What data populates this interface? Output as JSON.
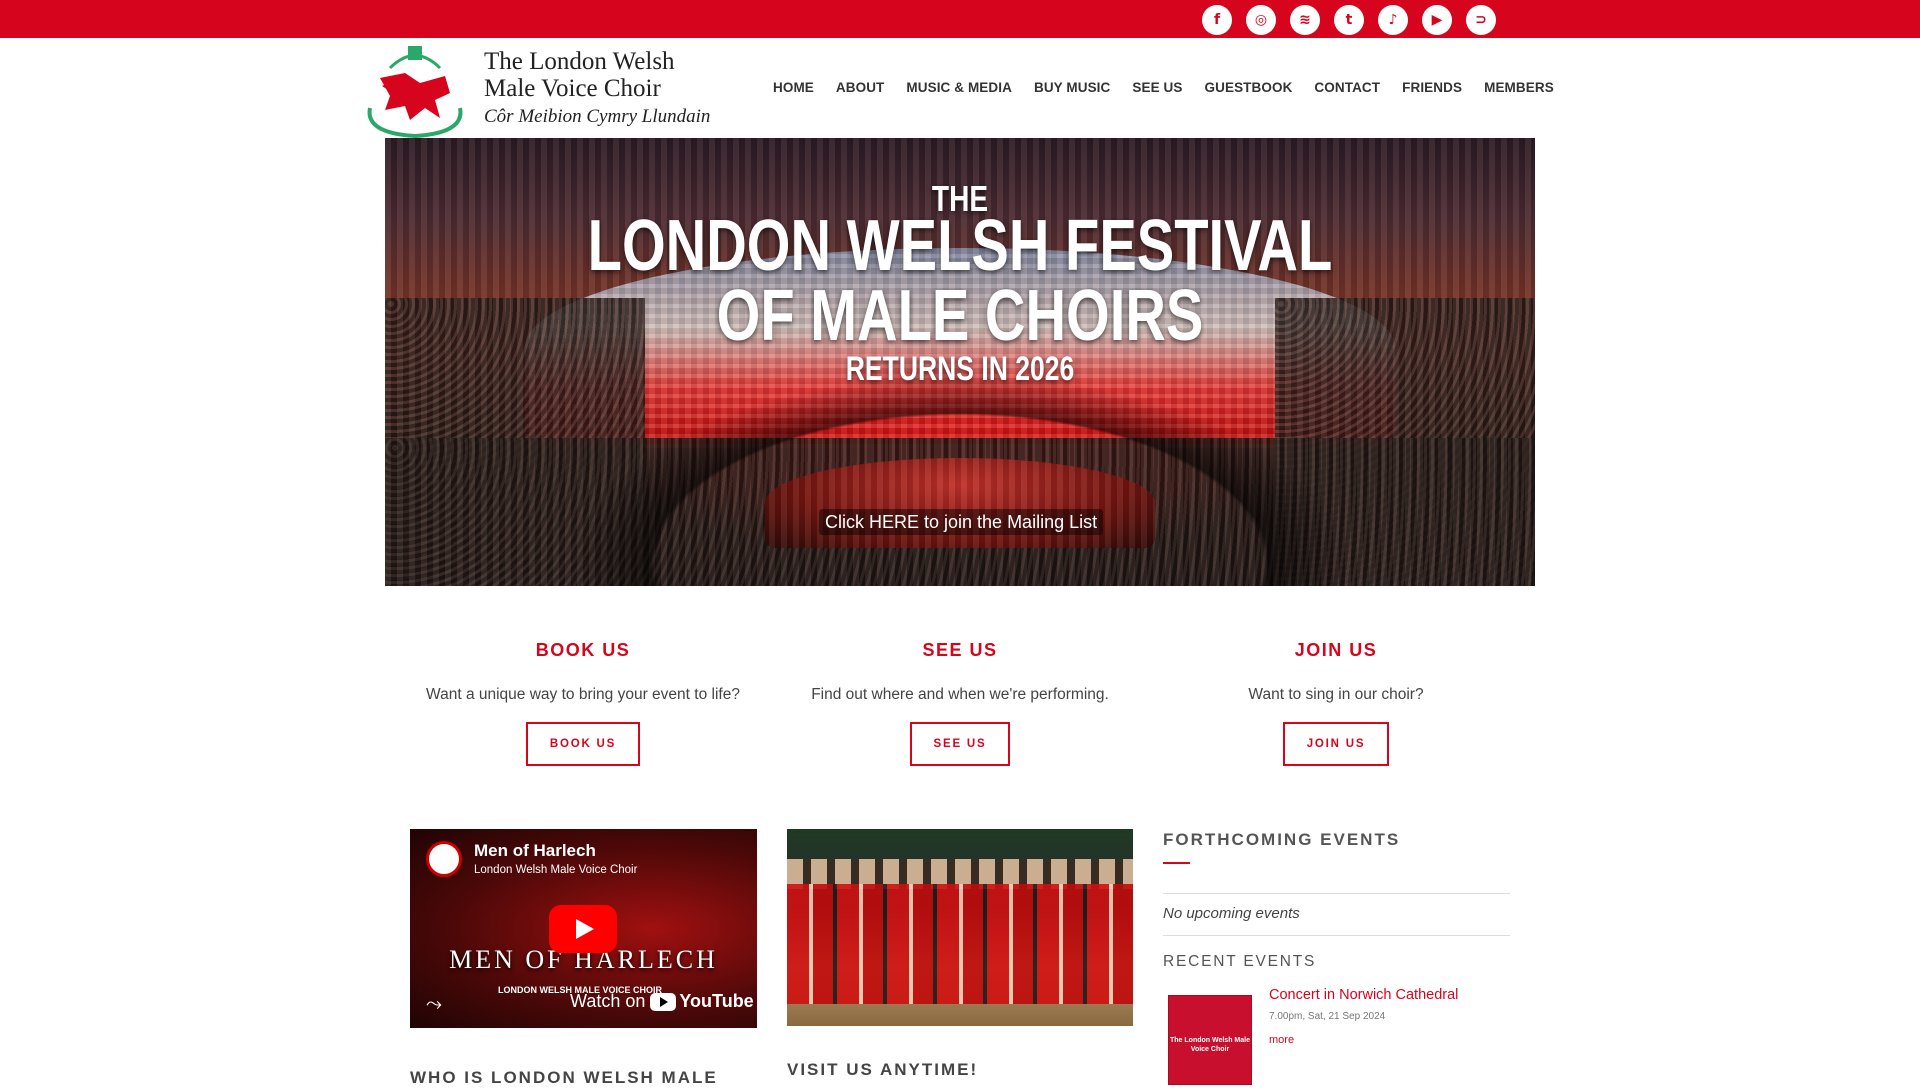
{
  "colors": {
    "brand_red": "#d6041c"
  },
  "social": [
    "facebook-icon",
    "instagram-icon",
    "spotify-icon",
    "twitter-icon",
    "tiktok-icon",
    "youtube-icon",
    "rss-icon"
  ],
  "social_glyphs": [
    "f",
    "◎",
    "≋",
    "t",
    "♪",
    "▶",
    "⊃"
  ],
  "brand": {
    "line1": "The London Welsh",
    "line2": "Male Voice Choir",
    "line3": "Côr Meibion Cymry Llundain"
  },
  "nav": [
    "HOME",
    "ABOUT",
    "MUSIC & MEDIA",
    "BUY MUSIC",
    "SEE US",
    "GUESTBOOK",
    "CONTACT",
    "FRIENDS",
    "MEMBERS"
  ],
  "hero": {
    "line1": "THE",
    "line2": "LONDON WELSH FESTIVAL",
    "line3": "OF MALE CHOIRS",
    "line4": "RETURNS IN 2026",
    "mailing": "Click HERE to join the Mailing List"
  },
  "ctas": [
    {
      "title": "BOOK US",
      "text": "Want a unique way to bring your event to life?",
      "button": "BOOK US"
    },
    {
      "title": "SEE US",
      "text": "Find out where and when we're performing.",
      "button": "SEE US"
    },
    {
      "title": "JOIN US",
      "text": "Want to sing in our choir?",
      "button": "JOIN US"
    }
  ],
  "video": {
    "title": "Men of Harlech",
    "channel": "London Welsh Male Voice Choir",
    "overlay_title": "MEN OF HARLECH",
    "overlay_sub": "LONDON WELSH MALE VOICE CHOIR",
    "watch_on": "Watch on",
    "youtube": "YouTube"
  },
  "headings": {
    "who": "WHO IS LONDON WELSH MALE",
    "visit": "VISIT US ANYTIME!"
  },
  "events": {
    "title": "FORTHCOMING EVENTS",
    "none": "No upcoming events",
    "recent_title": "RECENT EVENTS",
    "recent": [
      {
        "name": "Concert in Norwich Cathedral",
        "date": "7.00pm, Sat, 21 Sep 2024",
        "more": "more",
        "poster_text": "The London Welsh Male Voice Choir"
      }
    ]
  }
}
